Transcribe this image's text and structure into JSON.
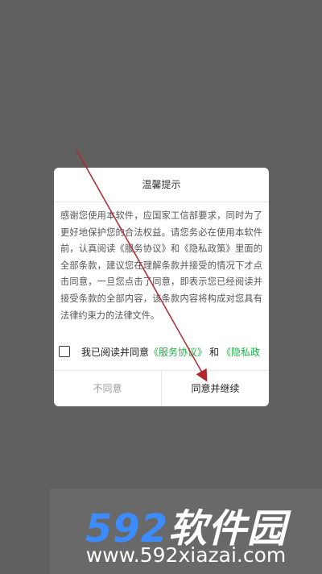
{
  "dialog": {
    "title": "温馨提示",
    "body": "感谢您使用本软件，应国家工信部要求，同时为了更好地保护您的合法权益。请您务必在使用本软件前，认真阅读《服务协议》和《隐私政策》里面的全部条款，建议您在理解条款并接受的情况下才点击同意，一旦您点击了同意，即表示您已经阅读并接受条款的全部内容，该条款内容将构成对您具有法律约束力的法律文件。",
    "agree_prefix": "我已阅读并同意",
    "service_link": "《服务协议》",
    "and": "和",
    "privacy_link": "《隐私政",
    "disagree_label": "不同意",
    "agree_label": "同意并继续"
  },
  "watermark": {
    "logo_number": "592",
    "logo_text": "软件园",
    "url": "www.592xiazai.com"
  },
  "colors": {
    "overlay": "#606060",
    "link": "#22b14c",
    "annotation_arrow": "#b0282d",
    "logo_blue": "#3c8cff"
  }
}
